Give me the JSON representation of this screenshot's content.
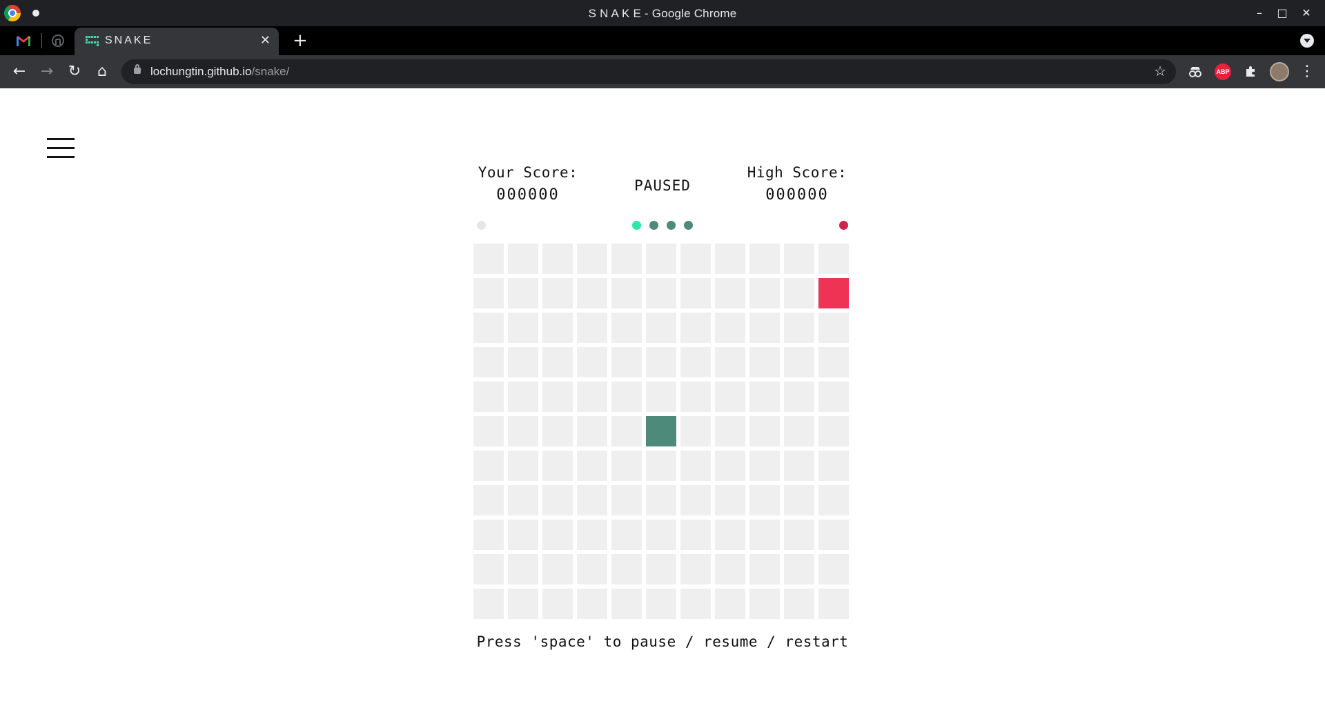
{
  "window": {
    "title": "S N A K E - Google Chrome",
    "minimize_glyph": "–",
    "maximize_glyph": "□",
    "close_glyph": "✕"
  },
  "tabs": {
    "pinned": [
      {
        "name": "gmail-tab",
        "icon": "gmail-icon"
      },
      {
        "name": "github-tab",
        "icon": "github-icon"
      }
    ],
    "active": {
      "label": "SNAKE",
      "icon": "snake-favicon"
    },
    "new_tab_glyph": "+"
  },
  "toolbar": {
    "url_host": "lochungtin.github.io",
    "url_path": "/snake/",
    "back_glyph": "←",
    "forward_glyph": "→",
    "reload_glyph": "↻",
    "home_glyph": "⌂",
    "star_glyph": "☆",
    "menu_glyph": "⋮",
    "extensions": [
      {
        "name": "incognito-extension-icon",
        "label": "",
        "color": "#e8eaed"
      },
      {
        "name": "adblock-plus-icon",
        "label": "ABP",
        "color": "#e8213a"
      },
      {
        "name": "puzzle-extensions-icon",
        "label": "",
        "color": "#e8eaed"
      }
    ]
  },
  "game": {
    "your_score_label": "Your Score:",
    "your_score": "000000",
    "status": "PAUSED",
    "high_score_label": "High Score:",
    "high_score": "000000",
    "hint": "Press 'space' to pause / resume / restart",
    "grid_size": 11,
    "food": {
      "row": 1,
      "col": 10
    },
    "snake": [
      {
        "row": 5,
        "col": 5
      }
    ],
    "colors": {
      "cell": "#efefef",
      "food": "#ee3355",
      "snake": "#4d8a7a",
      "dot_left": "#e6e6e6",
      "dot_active": "#2ee6a6",
      "dot_inactive": "#4d8a7a",
      "dot_right": "#d0254a"
    },
    "level_dots": [
      "active",
      "inactive",
      "inactive",
      "inactive"
    ]
  }
}
